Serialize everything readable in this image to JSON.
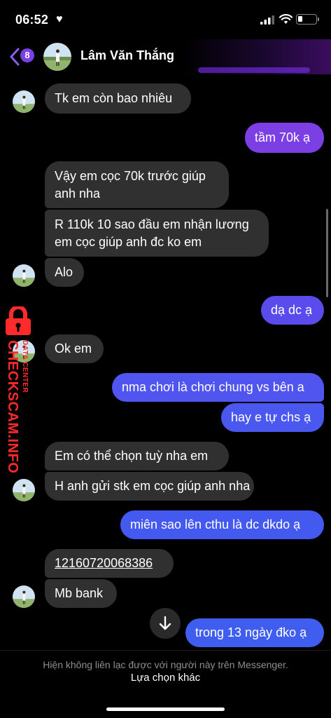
{
  "status_bar": {
    "time": "06:52"
  },
  "header": {
    "unread_count": "8",
    "contact_name": "Lâm Văn Thắng"
  },
  "messages": [
    {
      "side": "in",
      "text": "Tk em còn bao nhiêu"
    },
    {
      "side": "out",
      "text": "tầm 70k ạ"
    },
    {
      "side": "in",
      "line1": "Vậy em cọc 70k trước giúp",
      "line2": "anh nha"
    },
    {
      "side": "in",
      "line1": "R 110k 10 sao đầu em nhận lương",
      "line2": "em cọc giúp anh đc ko em"
    },
    {
      "side": "in",
      "text": "Alo"
    },
    {
      "side": "out",
      "text": "dạ dc ạ"
    },
    {
      "side": "in",
      "text": "Ok em"
    },
    {
      "side": "out",
      "text": "nma chơi là chơi chung vs bên a"
    },
    {
      "side": "out",
      "text": "hay e tự chs ạ"
    },
    {
      "side": "in",
      "text": "Em có thể chọn tuỳ nha em"
    },
    {
      "side": "in",
      "text": "H anh gửi stk em cọc giúp anh nha"
    },
    {
      "side": "out",
      "text": "miên sao lên cthu là dc dkdo ạ"
    },
    {
      "side": "in",
      "text": "12160720068386"
    },
    {
      "side": "in",
      "text": "Mb bank"
    },
    {
      "side": "out",
      "text": "trong 13 ngày đko ạ"
    }
  ],
  "watermark": {
    "main": "CHECKSCAM.INFO",
    "sub": "DATA CENTER"
  },
  "footer": {
    "notice": "Hiện không liên lạc được với người này trên Messenger.",
    "link": "Lựa chọn khác"
  },
  "colors": {
    "outgoing_top": "#7b3fe4",
    "outgoing_bottom": "#3f5ef0",
    "incoming": "#303030",
    "badge": "#7b3fe4"
  },
  "icons": [
    "heart-icon",
    "signal-icon",
    "wifi-icon",
    "battery-icon",
    "back-chevron-icon",
    "scroll-down-arrow-icon",
    "lock-icon"
  ]
}
